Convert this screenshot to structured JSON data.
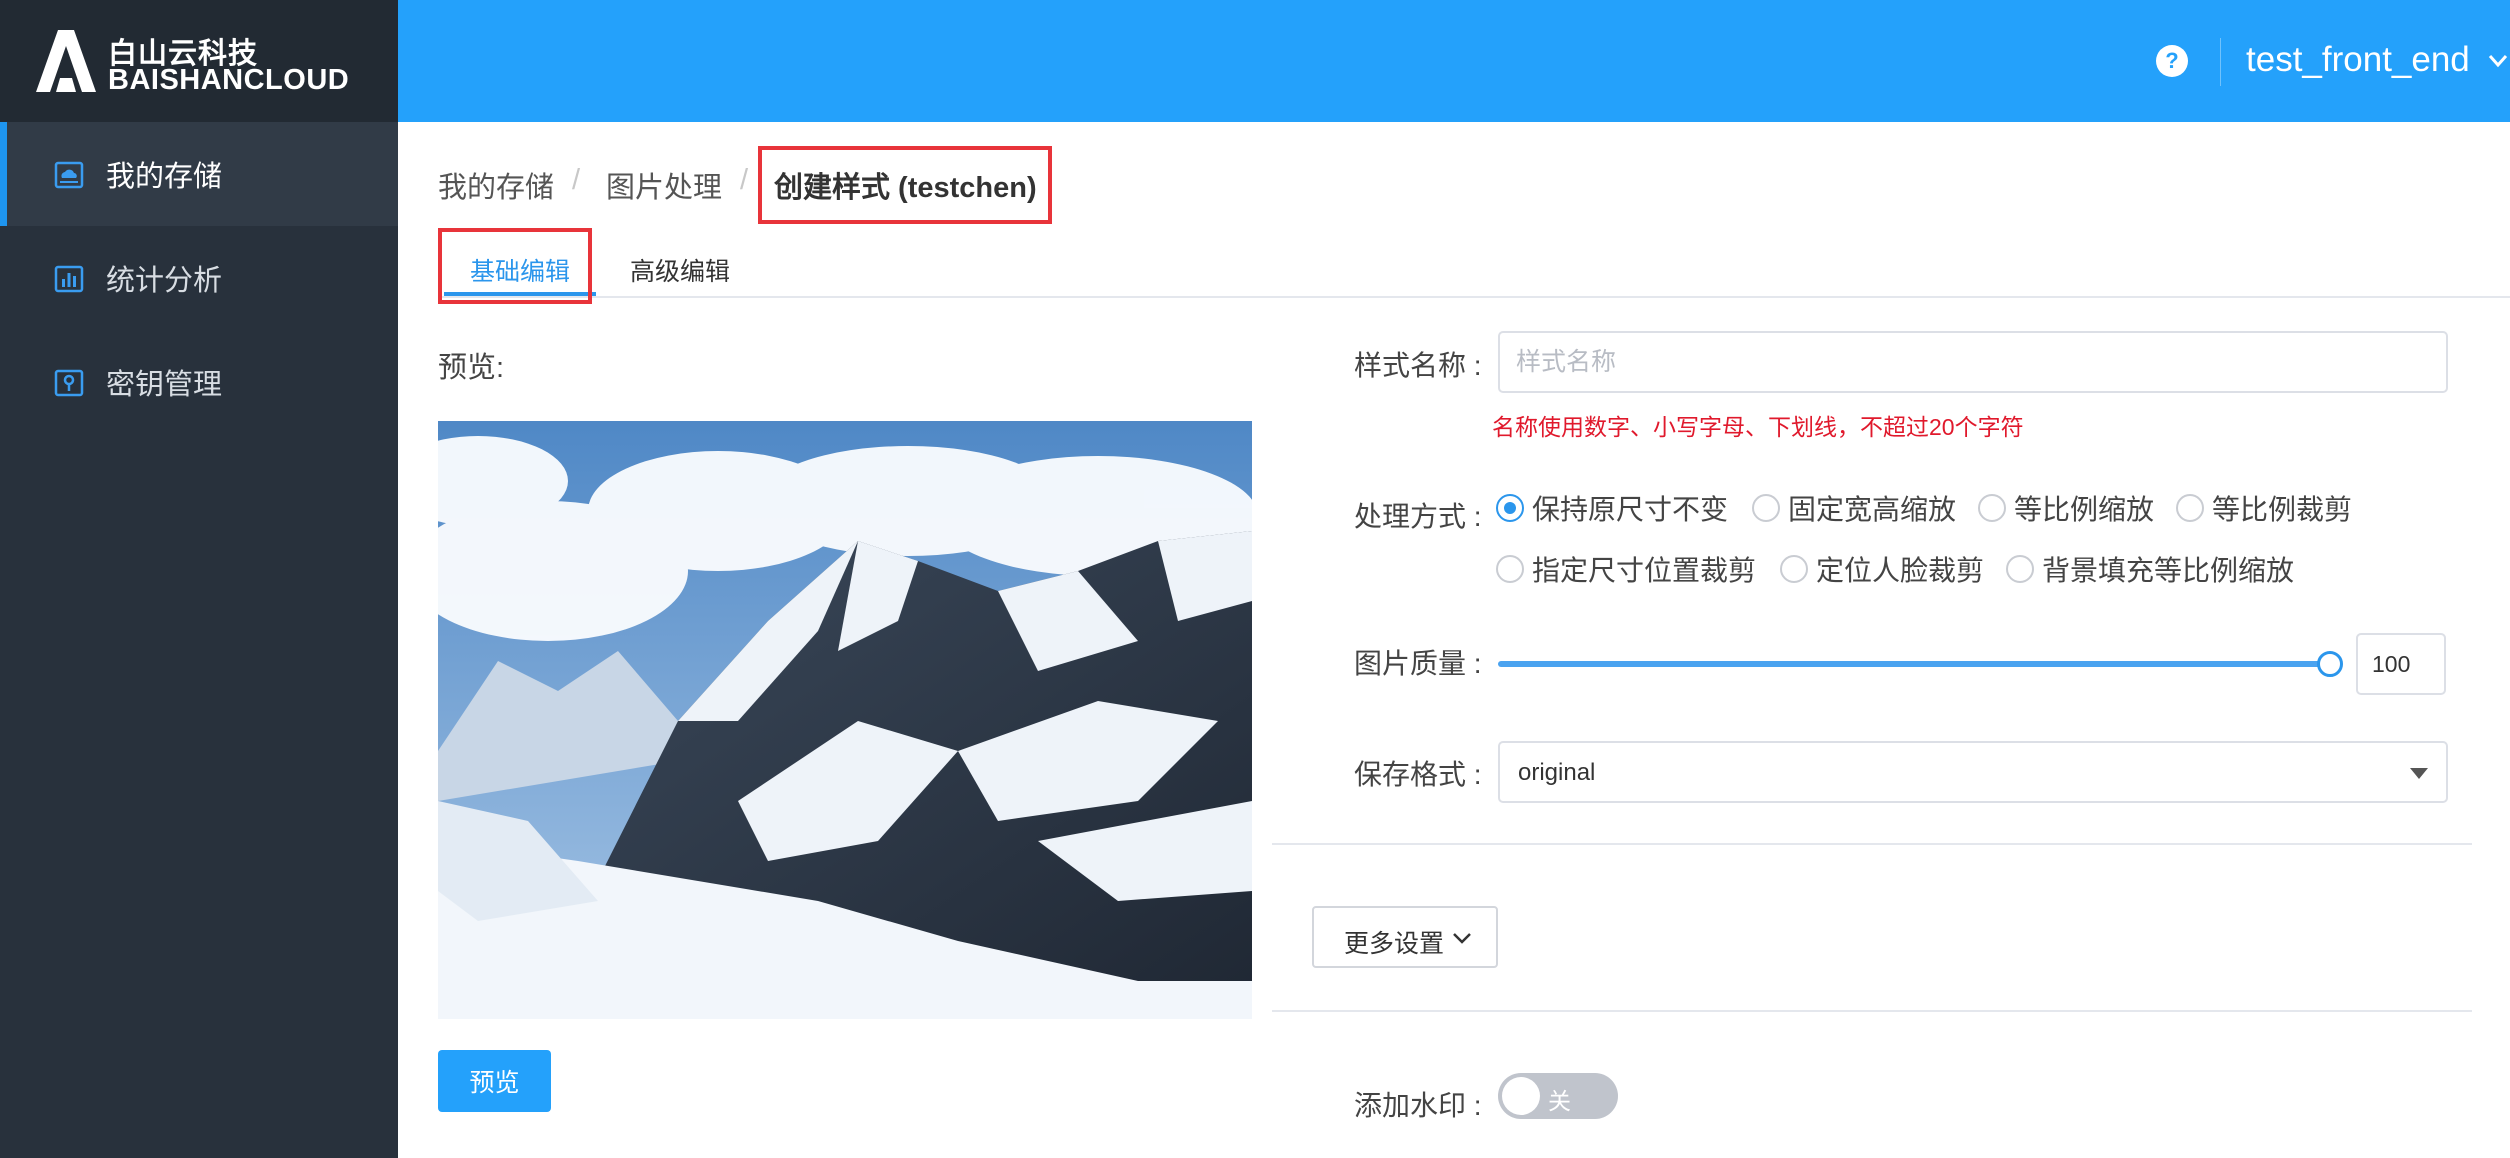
{
  "brand": {
    "name_cn": "白山云科技",
    "name_en": "BAISHANCLOUD",
    "logo_icon": "mountain-logo-icon"
  },
  "sidebar": {
    "items": [
      {
        "label": "我的存储",
        "icon": "cloud-storage-icon",
        "active": true
      },
      {
        "label": "统计分析",
        "icon": "bar-chart-icon",
        "active": false
      },
      {
        "label": "密钥管理",
        "icon": "key-icon",
        "active": false
      }
    ]
  },
  "header": {
    "help_icon": "?",
    "user_name": "test_front_end"
  },
  "breadcrumb": {
    "items": [
      "我的存储",
      "图片处理"
    ],
    "separator": "/",
    "current": "创建样式 (testchen)"
  },
  "tabs": [
    {
      "label": "基础编辑",
      "active": true
    },
    {
      "label": "高级编辑",
      "active": false
    }
  ],
  "preview": {
    "label": "预览:",
    "button_label": "预览"
  },
  "form": {
    "style_name": {
      "label": "样式名称 :",
      "placeholder": "样式名称",
      "value": "",
      "hint": "名称使用数字、小写字母、下划线，不超过20个字符"
    },
    "process_mode": {
      "label": "处理方式 :",
      "options": [
        "保持原尺寸不变",
        "固定宽高缩放",
        "等比例缩放",
        "等比例裁剪",
        "指定尺寸位置裁剪",
        "定位人脸裁剪",
        "背景填充等比例缩放"
      ],
      "selected": "保持原尺寸不变"
    },
    "quality": {
      "label": "图片质量 :",
      "value": "100",
      "level_percent": 100
    },
    "format": {
      "label": "保存格式 :",
      "value": "original"
    },
    "more_settings_label": "更多设置",
    "watermark": {
      "label": "添加水印 :",
      "toggle_text": "关",
      "on": false
    }
  },
  "colors": {
    "header": "#24a1fb",
    "sidebar": "#28313c",
    "accent": "#2b96ec",
    "hint_red": "#e0192c",
    "highlight_box": "#e8343a"
  }
}
